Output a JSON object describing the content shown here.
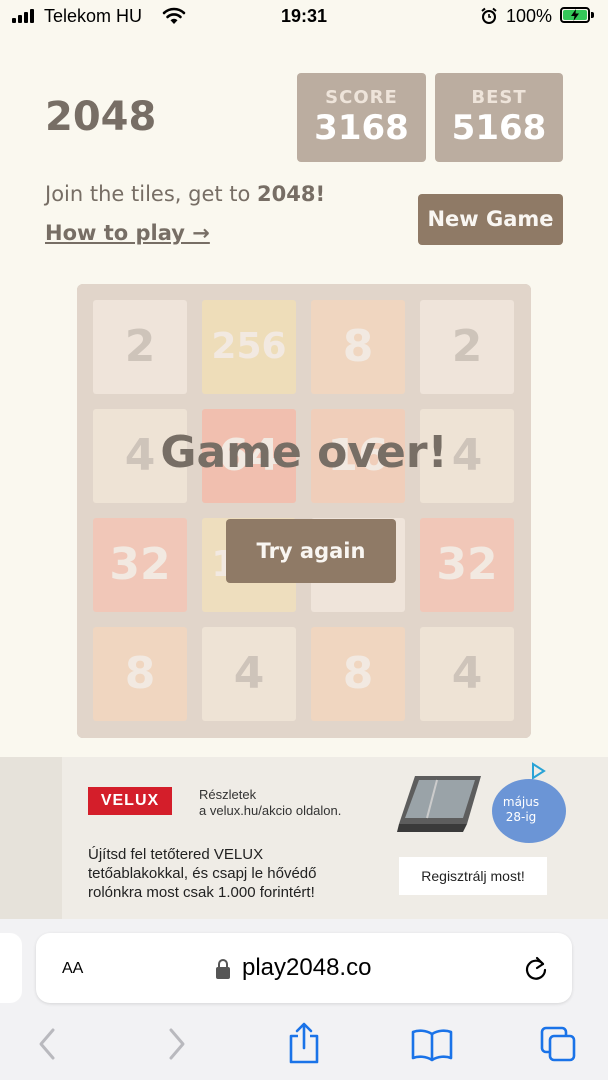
{
  "status_bar": {
    "carrier": "Telekom HU",
    "time": "19:31",
    "battery": "100%"
  },
  "game": {
    "title": "2048",
    "score_label": "SCORE",
    "score_value": "3168",
    "best_label": "BEST",
    "best_value": "5168",
    "intro_prefix": "Join the tiles, get to ",
    "intro_strong": "2048!",
    "how_to_play": "How to play →",
    "new_game": "New Game",
    "game_over": "Game over!",
    "try_again": "Try again",
    "board": [
      [
        "2",
        "256",
        "8",
        "2"
      ],
      [
        "4",
        "64",
        "16",
        "4"
      ],
      [
        "32",
        "128",
        "",
        "32"
      ],
      [
        "8",
        "4",
        "8",
        "4"
      ]
    ]
  },
  "ad": {
    "brand": "VELUX",
    "small_line1": "Részletek",
    "small_line2": "a velux.hu/akcio oldalon.",
    "body_line1": "Újítsd fel tetőtered VELUX",
    "body_line2": "tetőablakokkal, és csapj le hővédő",
    "body_line3": "rolónkra most csak 1.000 forintért!",
    "date_line1": "május",
    "date_line2": "28-ig",
    "register": "Regisztrálj most!"
  },
  "browser": {
    "text_size": "AA",
    "url": "play2048.co"
  },
  "colors": {
    "background": "#faf8ef",
    "board": "#bbada0",
    "button": "#8f7a66",
    "text": "#776e65"
  }
}
